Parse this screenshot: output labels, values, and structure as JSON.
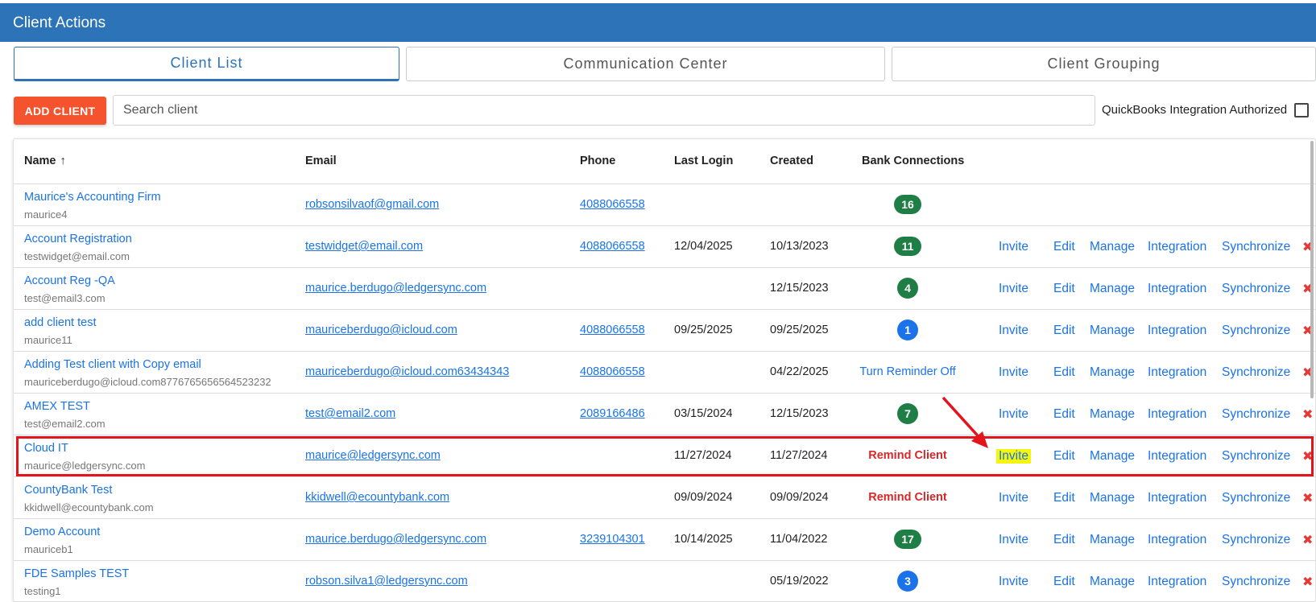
{
  "header": {
    "title": "Client Actions"
  },
  "tabs": [
    {
      "label": "Client List",
      "active": true
    },
    {
      "label": "Communication Center",
      "active": false
    },
    {
      "label": "Client Grouping",
      "active": false
    }
  ],
  "toolbar": {
    "add_label": "ADD CLIENT",
    "search_placeholder": "Search client",
    "qb_label": "QuickBooks Integration Authorized"
  },
  "columns": {
    "name": "Name",
    "email": "Email",
    "phone": "Phone",
    "last_login": "Last Login",
    "created": "Created",
    "bank": "Bank Connections"
  },
  "actions": {
    "invite": "Invite",
    "edit": "Edit",
    "manage": "Manage",
    "integration": "Integration",
    "synchronize": "Synchronize",
    "delete": "✖"
  },
  "rows": [
    {
      "name": "Maurice's Accounting Firm",
      "sub": "maurice4",
      "email": "robsonsilvaof@gmail.com",
      "phone": "4088066558",
      "last_login": "",
      "created": "",
      "bank": "16",
      "bank_kind": "badge",
      "bank_color": "#1e7e45",
      "actions": false
    },
    {
      "name": "Account Registration",
      "sub": "testwidget@email.com",
      "email": "testwidget@email.com",
      "phone": "4088066558",
      "last_login": "12/04/2025",
      "created": "10/13/2023",
      "bank": "11",
      "bank_kind": "badge",
      "bank_color": "#1e7e45",
      "actions": true
    },
    {
      "name": "Account Reg -QA",
      "sub": "test@email3.com",
      "email": "maurice.berdugo@ledgersync.com",
      "phone": "",
      "last_login": "",
      "created": "12/15/2023",
      "bank": "4",
      "bank_kind": "circle",
      "bank_color": "#1e7e45",
      "actions": true
    },
    {
      "name": "add client test",
      "sub": "maurice11",
      "email": "mauriceberdugo@icloud.com",
      "phone": "4088066558",
      "last_login": "09/25/2025",
      "created": "09/25/2025",
      "bank": "1",
      "bank_kind": "circle",
      "bank_color": "#1a73e8",
      "actions": true
    },
    {
      "name": "Adding Test client with Copy email",
      "sub": "mauriceberdugo@icloud.com8776765656564523232",
      "email": "mauriceberdugo@icloud.com63434343",
      "phone": "4088066558",
      "last_login": "",
      "created": "04/22/2025",
      "bank": "Turn Reminder Off",
      "bank_kind": "reminder",
      "bank_color": "#1a73e8",
      "actions": true
    },
    {
      "name": "AMEX TEST",
      "sub": "test@email2.com",
      "email": "test@email2.com",
      "phone": "2089166486",
      "last_login": "03/15/2024",
      "created": "12/15/2023",
      "bank": "7",
      "bank_kind": "circle",
      "bank_color": "#1e7e45",
      "actions": true
    },
    {
      "name": "Cloud IT",
      "sub": "maurice@ledgersync.com",
      "email": "maurice@ledgersync.com",
      "phone": "",
      "last_login": "11/27/2024",
      "created": "11/27/2024",
      "bank": "Remind Client",
      "bank_kind": "remind",
      "bank_color": "#d62828",
      "actions": true,
      "highlight": true
    },
    {
      "name": "CountyBank Test",
      "sub": "kkidwell@ecountybank.com",
      "email": "kkidwell@ecountybank.com",
      "phone": "",
      "last_login": "09/09/2024",
      "created": "09/09/2024",
      "bank": "Remind Client",
      "bank_kind": "remind",
      "bank_color": "#d62828",
      "actions": true
    },
    {
      "name": "Demo Account",
      "sub": "mauriceb1",
      "email": "maurice.berdugo@ledgersync.com",
      "phone": "3239104301",
      "last_login": "10/14/2025",
      "created": "11/04/2022",
      "bank": "17",
      "bank_kind": "badge",
      "bank_color": "#1e7e45",
      "actions": true
    },
    {
      "name": "FDE Samples TEST",
      "sub": "testing1",
      "email": "robson.silva1@ledgersync.com",
      "phone": "",
      "last_login": "",
      "created": "05/19/2022",
      "bank": "3",
      "bank_kind": "circle",
      "bank_color": "#1a73e8",
      "actions": true
    }
  ]
}
